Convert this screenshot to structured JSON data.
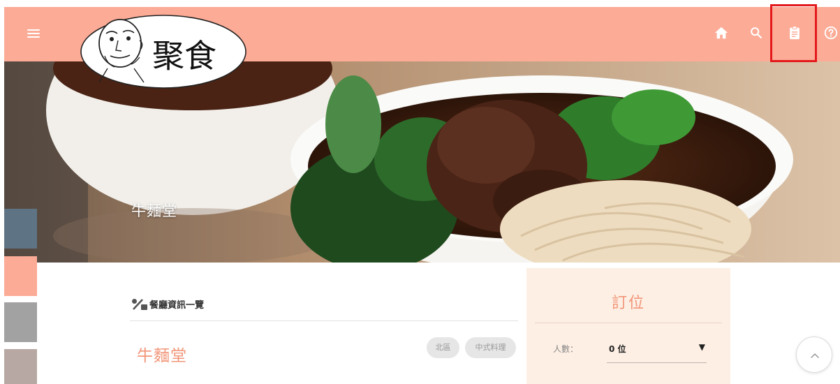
{
  "logo": {
    "text": "聚食"
  },
  "hero": {
    "title": "牛麵堂"
  },
  "nav": {
    "icons": [
      "menu-icon",
      "home-icon",
      "search-icon",
      "clipboard-icon",
      "help-icon"
    ]
  },
  "colors": {
    "topbar": "#fbab96",
    "highlight": "#e3191c",
    "accent_text": "#f29578",
    "booking_bg": "#fdefe4",
    "side_tabs": [
      "#5e7485",
      "#fbab96",
      "#a2a2a2",
      "#b8a8a3"
    ]
  },
  "info": {
    "section_title": "餐廳資訊一覽",
    "restaurant_name": "牛麵堂",
    "tags": [
      "北區",
      "中式料理"
    ]
  },
  "booking": {
    "title": "訂位",
    "people_label": "人數：",
    "people_value": "0 位"
  }
}
